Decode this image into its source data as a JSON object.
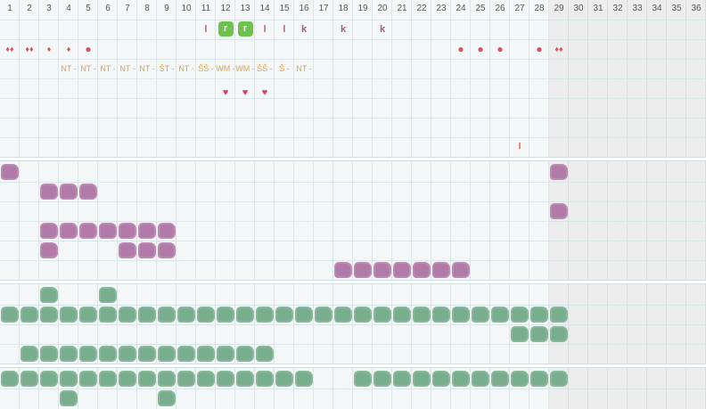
{
  "calendar": {
    "days": [
      "1",
      "2",
      "3",
      "4",
      "5",
      "6",
      "7",
      "8",
      "9",
      "10",
      "11",
      "12",
      "13",
      "14",
      "15",
      "16",
      "17",
      "18",
      "19",
      "20",
      "21",
      "22",
      "23",
      "24",
      "25",
      "26",
      "27",
      "28",
      "29",
      "30",
      "31",
      "32",
      "33",
      "34",
      "35",
      "36"
    ],
    "grey_from_day": 29
  },
  "symbols": [
    {
      "day": 11,
      "row": 0,
      "kind": "letter",
      "text": "l",
      "color": "#c07070"
    },
    {
      "day": 12,
      "row": 0,
      "kind": "green-box",
      "text": "r"
    },
    {
      "day": 13,
      "row": 0,
      "kind": "green-box",
      "text": "r"
    },
    {
      "day": 14,
      "row": 0,
      "kind": "letter",
      "text": "l",
      "color": "#c07070"
    },
    {
      "day": 15,
      "row": 0,
      "kind": "letter",
      "text": "l",
      "color": "#c07070"
    },
    {
      "day": 16,
      "row": 0,
      "kind": "letter",
      "text": "k",
      "color": "#a05a8a"
    },
    {
      "day": 18,
      "row": 0,
      "kind": "letter",
      "text": "k",
      "color": "#a05a8a"
    },
    {
      "day": 20,
      "row": 0,
      "kind": "letter",
      "text": "k",
      "color": "#a05a8a"
    },
    {
      "day": 1,
      "row": 1,
      "kind": "drop",
      "text": "♦♦"
    },
    {
      "day": 2,
      "row": 1,
      "kind": "drop",
      "text": "♦♦"
    },
    {
      "day": 3,
      "row": 1,
      "kind": "drop",
      "text": "♦"
    },
    {
      "day": 4,
      "row": 1,
      "kind": "drop",
      "text": "♦"
    },
    {
      "day": 5,
      "row": 1,
      "kind": "dot",
      "text": "●"
    },
    {
      "day": 24,
      "row": 1,
      "kind": "dot",
      "text": "●"
    },
    {
      "day": 25,
      "row": 1,
      "kind": "dot",
      "text": "●"
    },
    {
      "day": 26,
      "row": 1,
      "kind": "dot",
      "text": "●"
    },
    {
      "day": 28,
      "row": 1,
      "kind": "dot",
      "text": "●"
    },
    {
      "day": 29,
      "row": 1,
      "kind": "drop",
      "text": "♦♦"
    },
    {
      "day": 4,
      "row": 2,
      "kind": "code",
      "text": "NT -"
    },
    {
      "day": 5,
      "row": 2,
      "kind": "code",
      "text": "NT -"
    },
    {
      "day": 6,
      "row": 2,
      "kind": "code",
      "text": "NT -"
    },
    {
      "day": 7,
      "row": 2,
      "kind": "code",
      "text": "NT -"
    },
    {
      "day": 8,
      "row": 2,
      "kind": "code",
      "text": "NT -"
    },
    {
      "day": 9,
      "row": 2,
      "kind": "code",
      "text": "ŠT -"
    },
    {
      "day": 10,
      "row": 2,
      "kind": "code",
      "text": "NT -"
    },
    {
      "day": 11,
      "row": 2,
      "kind": "code",
      "text": "ŠŠ -"
    },
    {
      "day": 12,
      "row": 2,
      "kind": "code",
      "text": "WM -"
    },
    {
      "day": 13,
      "row": 2,
      "kind": "code",
      "text": "WM -"
    },
    {
      "day": 14,
      "row": 2,
      "kind": "code",
      "text": "ŠŠ -"
    },
    {
      "day": 15,
      "row": 2,
      "kind": "code",
      "text": "Š -"
    },
    {
      "day": 16,
      "row": 2,
      "kind": "code",
      "text": "NT -"
    },
    {
      "day": 12,
      "row": 4,
      "kind": "heart",
      "text": "♥"
    },
    {
      "day": 13,
      "row": 4,
      "kind": "heart",
      "text": "♥"
    },
    {
      "day": 14,
      "row": 4,
      "kind": "heart",
      "text": "♥"
    },
    {
      "day": 27,
      "row": 7,
      "kind": "tick",
      "text": "I"
    }
  ],
  "section1_purple": [
    [
      1,
      29
    ],
    [
      3,
      4,
      5
    ],
    [
      29
    ],
    [
      3,
      4,
      5,
      6,
      7,
      8,
      9
    ],
    [
      3,
      7,
      8,
      9
    ],
    [
      18,
      19,
      20,
      21,
      22,
      23,
      24
    ]
  ],
  "section2_green": [
    [
      3,
      6
    ],
    [
      1,
      2,
      3,
      4,
      5,
      6,
      7,
      8,
      9,
      10,
      11,
      12,
      13,
      14,
      15,
      16,
      17,
      18,
      19,
      20,
      21,
      22,
      23,
      24,
      25,
      26,
      27,
      28,
      29
    ],
    [
      27,
      28,
      29
    ],
    [
      2,
      3,
      4,
      5,
      6,
      7,
      8,
      9,
      10,
      11,
      12,
      13,
      14
    ]
  ],
  "section3_green": [
    [
      1,
      2,
      3,
      4,
      5,
      6,
      7,
      8,
      9,
      10,
      11,
      12,
      13,
      14,
      15,
      16,
      19,
      20,
      21,
      22,
      23,
      24,
      25,
      26,
      27,
      28,
      29
    ],
    [
      4,
      9
    ]
  ],
  "colors": {
    "purple": "#b27aa8",
    "green": "#78ae8e"
  }
}
